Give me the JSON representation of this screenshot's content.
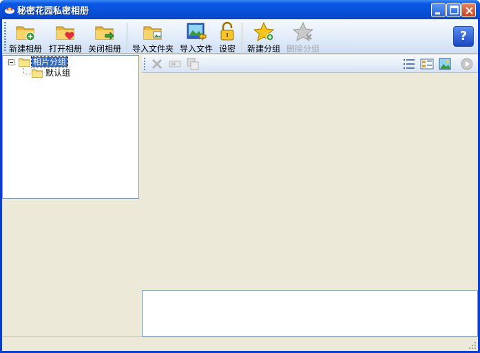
{
  "window": {
    "title": "秘密花园私密相册"
  },
  "titlebar_buttons": [
    "minimize",
    "maximize",
    "close"
  ],
  "toolbar": {
    "new_album": "新建相册",
    "open_album": "打开相册",
    "close_album": "关闭相册",
    "import_folder": "导入文件夹",
    "import_file": "导入文件",
    "set_password": "设密",
    "new_group": "新建分组",
    "delete_group": "删除分组",
    "help": "?"
  },
  "tree": {
    "root_label": "相片分组",
    "child_label": "默认组"
  },
  "colors": {
    "titlebar": "#0a58e6",
    "selection": "#316ac5",
    "panel_bg": "#ece9d8"
  }
}
